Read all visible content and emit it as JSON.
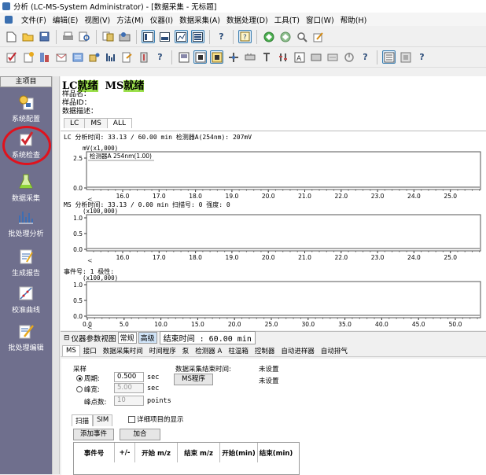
{
  "window": {
    "title": "分析 (LC-MS-System Administrator) - [数据采集 - 无标题]"
  },
  "menu": [
    "文件(F)",
    "编辑(E)",
    "视图(V)",
    "方法(M)",
    "仪器(I)",
    "数据采集(A)",
    "数据处理(D)",
    "工具(T)",
    "窗口(W)",
    "帮助(H)"
  ],
  "sidebar": {
    "header": "主项目",
    "items": [
      {
        "label": "系统配置",
        "icon": "system-config-icon"
      },
      {
        "label": "系统检查",
        "icon": "system-check-icon"
      },
      {
        "label": "数据采集",
        "icon": "flask-icon"
      },
      {
        "label": "批处理分析",
        "icon": "batch-analysis-icon"
      },
      {
        "label": "生成报告",
        "icon": "report-icon"
      },
      {
        "label": "校准曲线",
        "icon": "calibration-icon"
      },
      {
        "label": "批处理编辑",
        "icon": "batch-edit-icon"
      }
    ]
  },
  "status": {
    "lc_label": "LC",
    "lc_state": "就绪",
    "ms_label": "MS",
    "ms_state": "就绪"
  },
  "meta": {
    "sample_name": "样品名：",
    "sample_id": "样品ID：",
    "data_desc": "数据描述："
  },
  "view_tabs": [
    "LC",
    "MS",
    "ALL"
  ],
  "lc_panel": {
    "info": "LC 分析时间: 33.13 / 60.00 min 检测器A(254nm): 207mV",
    "y_unit": "mV(x1,000)",
    "legend": "检测器A 254nm(1.00)",
    "y_ticks": [
      "2.5",
      "0.0"
    ],
    "x_ticks": [
      "16.0",
      "17.0",
      "18.0",
      "19.0",
      "20.0",
      "21.0",
      "22.0",
      "23.0",
      "24.0",
      "25.0"
    ]
  },
  "ms_panel": {
    "info": "MS 分析时间: 33.13 / 0.00 min 扫描号: 0 强度: 0",
    "y_unit": "(x100,000)",
    "y_ticks": [
      "1.0",
      "0.5",
      "0.0"
    ],
    "x_ticks": [
      "16.0",
      "17.0",
      "18.0",
      "19.0",
      "20.0",
      "21.0",
      "22.0",
      "23.0",
      "24.0",
      "25.0"
    ]
  },
  "event_panel": {
    "info": "事件号: 1 极性:",
    "y_unit": "(x100,000)",
    "y_ticks": [
      "1.0",
      "0.5",
      "0.0"
    ],
    "x_ticks": [
      "0.0",
      "5.0",
      "10.0",
      "15.0",
      "20.0",
      "25.0",
      "30.0",
      "35.0",
      "40.0",
      "45.0",
      "50.0"
    ]
  },
  "params": {
    "title": "仪器参数视图",
    "normal": "常规",
    "advanced": "高级",
    "end_time": "结束时间 : 60.00 min",
    "tabs": [
      "MS",
      "接口",
      "数据采集时间",
      "时间程序",
      "泵",
      "检测器 A",
      "柱温箱",
      "控制器",
      "自动进样器",
      "自动排气"
    ],
    "sampling_label": "采样",
    "period_label": "周期:",
    "period_value": "0.500",
    "period_unit": "sec",
    "peak_width_label": "峰宽:",
    "peak_width_value": "5.00",
    "peak_width_unit": "sec",
    "peak_points_label": "峰点数:",
    "peak_points_value": "10",
    "peak_points_unit": "points",
    "acq_end_label": "数据采集结束时间:",
    "acq_end_value": "未设置",
    "ms_program_button": "MS程序",
    "ms_program_value": "未设置",
    "scan_tabs": [
      "扫描",
      "SIM"
    ],
    "detail_check": "详细项目的显示",
    "add_event": "添加事件",
    "merge": "加合",
    "table_headers": [
      "事件号",
      "+/-",
      "开始 m/z",
      "结束 m/z",
      "开始(min)",
      "结束(min)"
    ]
  }
}
